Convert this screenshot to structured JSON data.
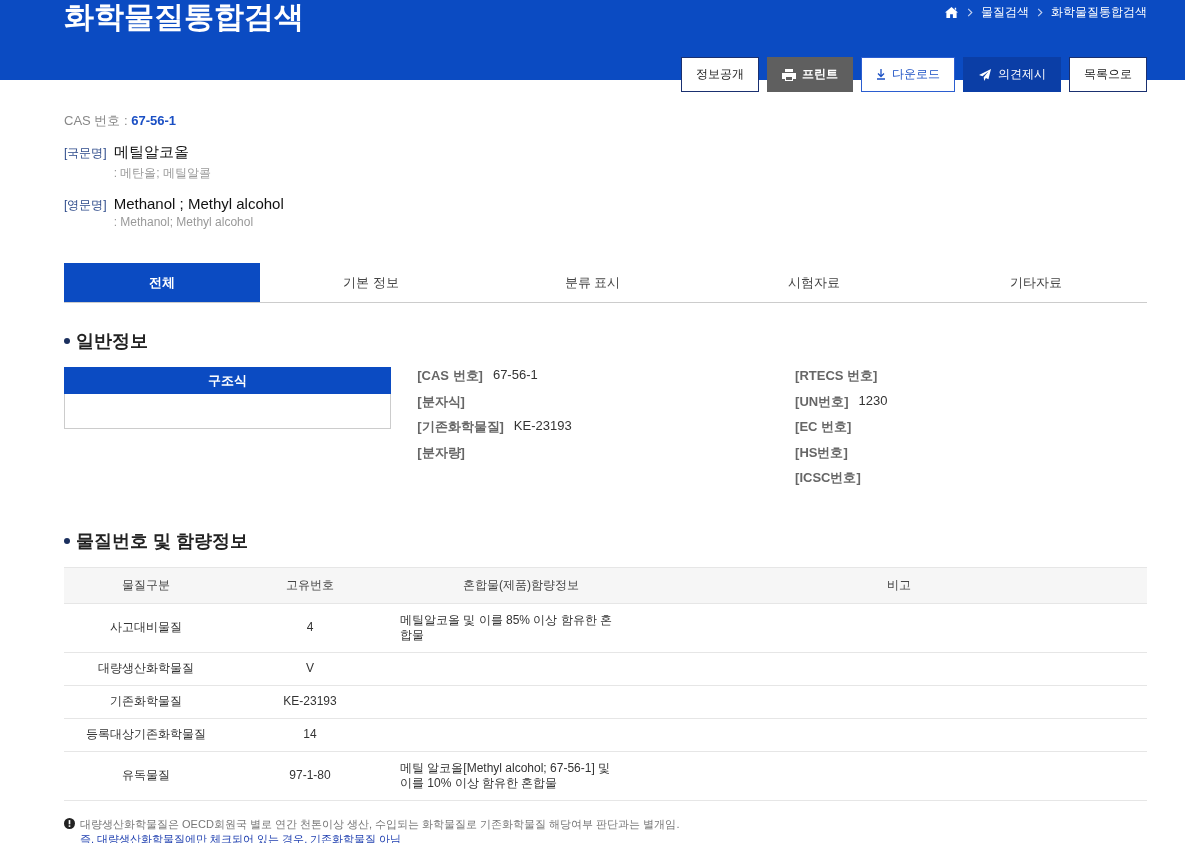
{
  "header": {
    "title": "화학물질통합검색",
    "breadcrumb": [
      "물질검색",
      "화학물질통합검색"
    ]
  },
  "actions": [
    {
      "label": "정보공개",
      "kind": "plain"
    },
    {
      "label": "프린트",
      "kind": "print"
    },
    {
      "label": "다운로드",
      "kind": "download"
    },
    {
      "label": "의견제시",
      "kind": "send"
    },
    {
      "label": "목록으로",
      "kind": "plain"
    }
  ],
  "substance": {
    "cas_label": "CAS 번호 :",
    "cas": "67-56-1",
    "names": [
      {
        "label": "[국문명]",
        "name": "메틸알코올",
        "synonyms": ": 메탄올; 메틸알콜"
      },
      {
        "label": "[영문명]",
        "name": "Methanol ; Methyl alcohol",
        "synonyms": ": Methanol; Methyl alcohol"
      }
    ]
  },
  "tabs": [
    {
      "label": "전체",
      "selected": true
    },
    {
      "label": "기본 정보",
      "selected": false
    },
    {
      "label": "분류 표시",
      "selected": false
    },
    {
      "label": "시험자료",
      "selected": false
    },
    {
      "label": "기타자료",
      "selected": false
    }
  ],
  "general": {
    "heading": "일반정보",
    "structure_title": "구조식",
    "left_fields": [
      {
        "label": "[CAS 번호]",
        "value": "67-56-1"
      },
      {
        "label": "[분자식]"
      },
      {
        "label": "[기존화학물질]",
        "value": "KE-23193"
      },
      {
        "label": "[분자량]"
      }
    ],
    "right_fields": [
      {
        "label": "[RTECS 번호]"
      },
      {
        "label": "[UN번호]",
        "value": "1230"
      },
      {
        "label": "[EC 번호]"
      },
      {
        "label": "[HS번호]"
      },
      {
        "label": "[ICSC번호]"
      }
    ]
  },
  "content": {
    "heading": "물질번호 및 함량정보",
    "columns": [
      "물질구분",
      "고유번호",
      "혼합물(제품)함량정보",
      "비고"
    ],
    "rows": [
      {
        "category": "사고대비물질",
        "number": "4",
        "mixture": "메틸알코올 및 이를 85% 이상 함유한 혼합물"
      },
      {
        "category": "대량생산화학물질",
        "number": "V"
      },
      {
        "category": "기존화학물질",
        "number": "KE-23193"
      },
      {
        "category": "등록대상기존화학물질",
        "number": "14"
      },
      {
        "category": "유독물질",
        "number": "97-1-80",
        "mixture": "메틸 알코올[Methyl alcohol; 67-56-1] 및 이를 10% 이상 함유한 혼합물"
      }
    ]
  },
  "notice": {
    "line1": "대량생산화학물질은 OECD회원국 별로 연간 천톤이상 생산, 수입되는 화학물질로 기존화학물질 해당여부 판단과는 별개임.",
    "line2": "즉, 대량생산화학물질에만 체크되어 있는 경우, 기존화학물질 아님"
  }
}
